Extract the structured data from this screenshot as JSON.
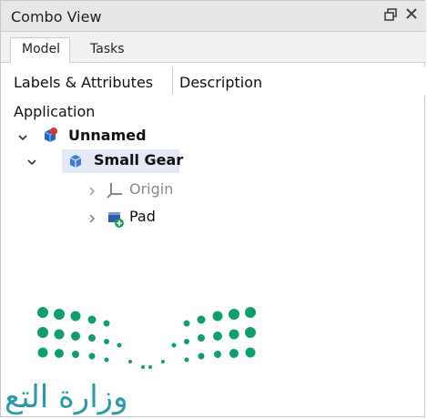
{
  "window": {
    "title": "Combo View"
  },
  "tabs": [
    {
      "label": "Model"
    },
    {
      "label": "Tasks"
    }
  ],
  "columns": {
    "labels": "Labels & Attributes",
    "description": "Description"
  },
  "tree": {
    "root_label": "Application",
    "items": [
      {
        "label": "Unnamed",
        "bold": true,
        "icon": "document-icon"
      },
      {
        "label": "Small Gear",
        "bold": true,
        "icon": "body-icon",
        "selected": true
      },
      {
        "label": "Origin",
        "bold": false,
        "icon": "origin-axes-icon",
        "dimmed": true
      },
      {
        "label": "Pad",
        "bold": false,
        "icon": "pad-feature-icon"
      }
    ]
  },
  "watermark": {
    "text": "وزارة التع"
  },
  "colors": {
    "selection": "#e3eaf6",
    "accent_teal": "#2c9aa8",
    "logo_green": "#0fa06a"
  }
}
